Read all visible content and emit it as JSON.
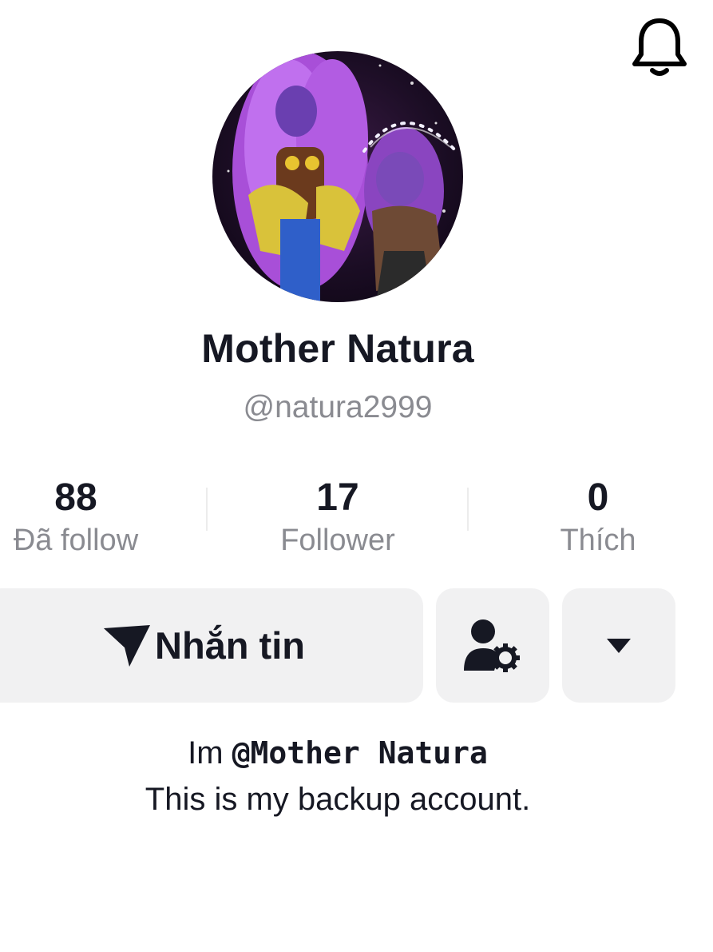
{
  "header": {
    "notification_icon": "bell-icon"
  },
  "profile": {
    "avatar_description": "profile-avatar",
    "display_name": "Mother Natura",
    "username": "@natura2999"
  },
  "stats": [
    {
      "value": "88",
      "label": "Đã follow"
    },
    {
      "value": "17",
      "label": "Follower"
    },
    {
      "value": "0",
      "label": "Thích"
    }
  ],
  "actions": {
    "message_label": "Nhắn tin",
    "message_icon": "send-icon",
    "friends_icon": "user-settings-icon",
    "more_icon": "caret-down-icon"
  },
  "bio": {
    "prefix": "Im ",
    "mention": "@Mother Natura",
    "line2": "This is my backup account."
  },
  "colors": {
    "text_primary": "#161823",
    "text_secondary": "#8a8b91",
    "button_bg": "#f1f1f2",
    "avatar_purple": "#a84fd8"
  }
}
